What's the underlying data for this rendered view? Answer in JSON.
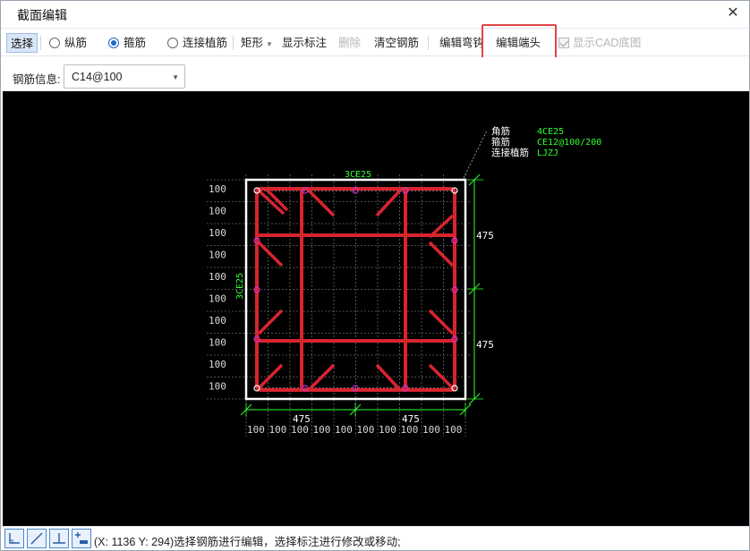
{
  "window": {
    "title": "截面编辑",
    "close_glyph": "✕"
  },
  "toolbar": {
    "select": "选择",
    "longitudinal": "纵筋",
    "stirrup": "箍筋",
    "connect_dowel": "连接植筋",
    "rect": "矩形",
    "show_dims": "显示标注",
    "delete": "删除",
    "clear_rebar": "清空钢筋",
    "edit_hook": "编辑弯钩",
    "edit_end": "编辑端头",
    "show_cad": "显示CAD底图",
    "selected_radio": "stirrup"
  },
  "info": {
    "rebar_label": "钢筋信息:",
    "rebar_value": "C14@100"
  },
  "drawing": {
    "legend": [
      {
        "key": "角筋",
        "value": "4CE25"
      },
      {
        "key": "箍筋",
        "value": "CE12@100/200"
      },
      {
        "key": "连接植筋",
        "value": "LJZJ"
      }
    ],
    "top_label": "3CE25",
    "left_label": "3CE25",
    "right_dims": [
      "475",
      "475"
    ],
    "bottom_dims": [
      "475",
      "475"
    ],
    "left_grid_labels": [
      "100",
      "100",
      "100",
      "100",
      "100",
      "100",
      "100",
      "100",
      "100",
      "100"
    ],
    "bottom_grid_labels": [
      "100",
      "100",
      "100",
      "100",
      "100",
      "100",
      "100",
      "100",
      "100",
      "100"
    ]
  },
  "status": {
    "text": "(X: 1136 Y: 294)选择钢筋进行编辑，选择标注进行修改或移动;"
  },
  "colors": {
    "stirrup_red": "#d8242f",
    "label_green": "#33ff33",
    "magenta": "#cc33cc",
    "accent_blue": "#1e66c8"
  }
}
